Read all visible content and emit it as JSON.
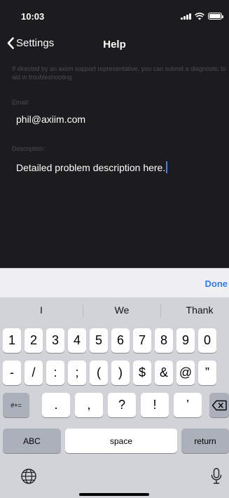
{
  "status_bar": {
    "time": "10:03"
  },
  "nav": {
    "back_label": "Settings",
    "title": "Help"
  },
  "intro": "If directed by an axiim support representative, you can submit a diagnostic to aid in troubleshooting.",
  "form": {
    "email_label": "Email:",
    "email_value": "phil@axiim.com",
    "description_label": "Description:",
    "description_value": "Detailed problem description here."
  },
  "keyboard": {
    "done_label": "Done",
    "suggestions": [
      "I",
      "We",
      "Thank"
    ],
    "row1": [
      "1",
      "2",
      "3",
      "4",
      "5",
      "6",
      "7",
      "8",
      "9",
      "0"
    ],
    "row2": [
      "-",
      "/",
      ":",
      ";",
      "(",
      ")",
      "$",
      "&",
      "@",
      "”"
    ],
    "row3_left": "#+=",
    "row3": [
      ".",
      ",",
      "?",
      "!",
      "’"
    ],
    "abc_label": "ABC",
    "space_label": "space",
    "return_label": "return",
    "icons": {
      "delete": "delete-backspace-icon",
      "globe": "globe-icon",
      "mic": "microphone-icon"
    }
  },
  "colors": {
    "accent": "#2f7cf6",
    "background": "#1c1c1e",
    "keyboard": "#d1d3d9"
  }
}
